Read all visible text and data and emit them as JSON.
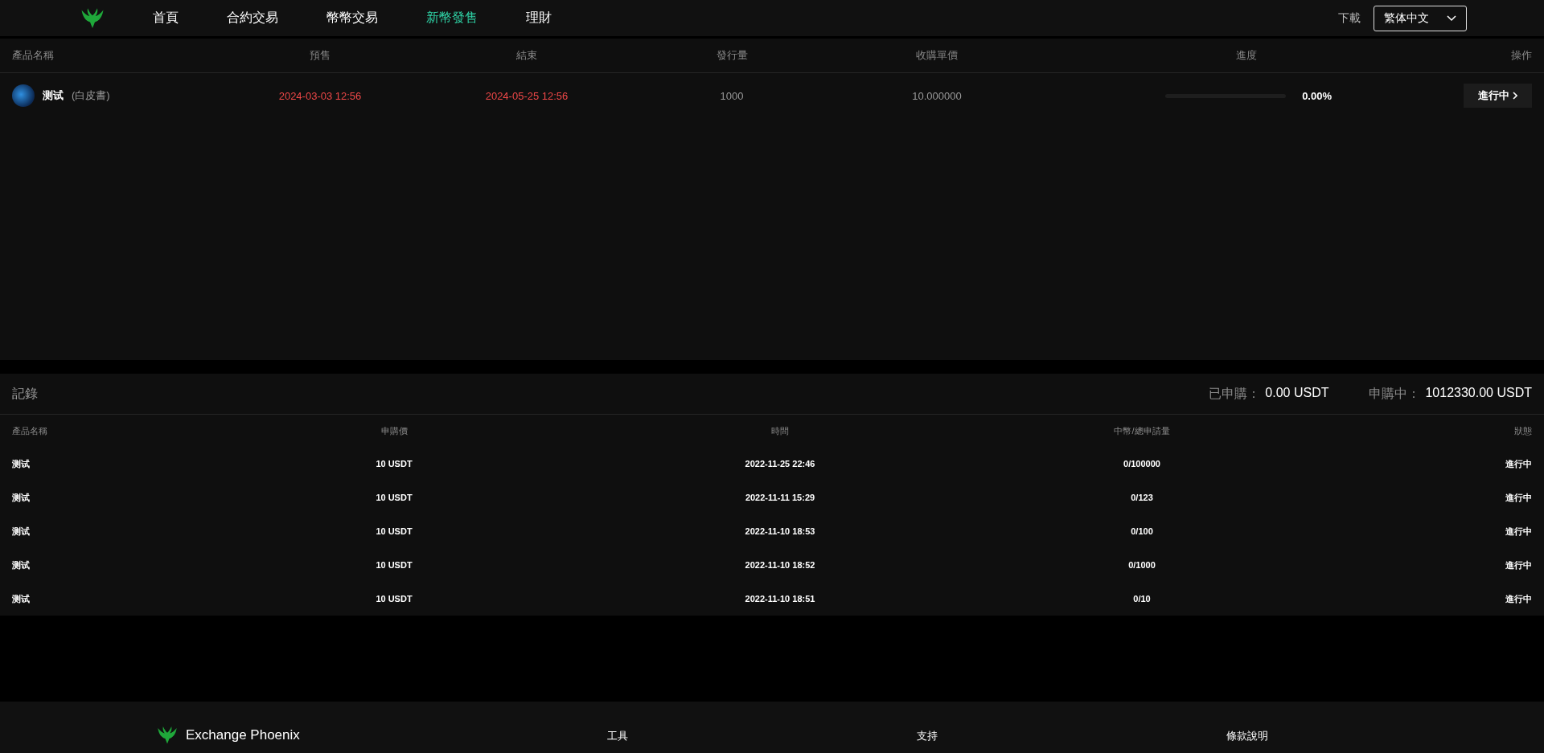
{
  "nav": {
    "items": [
      {
        "label": "首頁",
        "selected": false
      },
      {
        "label": "合約交易",
        "selected": false
      },
      {
        "label": "幣幣交易",
        "selected": false
      },
      {
        "label": "新幣發售",
        "selected": true
      },
      {
        "label": "理財",
        "selected": false
      }
    ]
  },
  "header_actions": {
    "download": "下載",
    "language": "繁体中文"
  },
  "products": {
    "columns": [
      "產品名稱",
      "預售",
      "結束",
      "發行量",
      "收購單價",
      "進度",
      "操作"
    ],
    "rows": [
      {
        "name": "测试",
        "whitepaper": "(白皮書)",
        "presale": "2024-03-03 12:56",
        "end": "2024-05-25 12:56",
        "issued": "1000",
        "price": "10.000000",
        "progress": {
          "level": 0,
          "reading": "0.00%"
        },
        "action": "進行中"
      }
    ]
  },
  "records": {
    "title": "記錄",
    "subscribed_label": "已申購：",
    "subscribed_value": "0.00 USDT",
    "pending_label": "申購中：",
    "pending_value": "1012330.00 USDT",
    "columns": [
      "產品名稱",
      "申購價",
      "時間",
      "中幣/總申請量",
      "狀態"
    ],
    "rows": [
      {
        "name": "测试",
        "price": "10 USDT",
        "time": "2022-11-25 22:46",
        "amount": "0/100000",
        "status": "進行中"
      },
      {
        "name": "测试",
        "price": "10 USDT",
        "time": "2022-11-11 15:29",
        "amount": "0/123",
        "status": "進行中"
      },
      {
        "name": "测试",
        "price": "10 USDT",
        "time": "2022-11-10 18:53",
        "amount": "0/100",
        "status": "進行中"
      },
      {
        "name": "测试",
        "price": "10 USDT",
        "time": "2022-11-10 18:52",
        "amount": "0/1000",
        "status": "進行中"
      },
      {
        "name": "测试",
        "price": "10 USDT",
        "time": "2022-11-10 18:51",
        "amount": "0/10",
        "status": "進行中"
      }
    ]
  },
  "footer": {
    "brand": "Exchange Phoenix",
    "columns": [
      "工具",
      "支持",
      "條款說明"
    ]
  }
}
